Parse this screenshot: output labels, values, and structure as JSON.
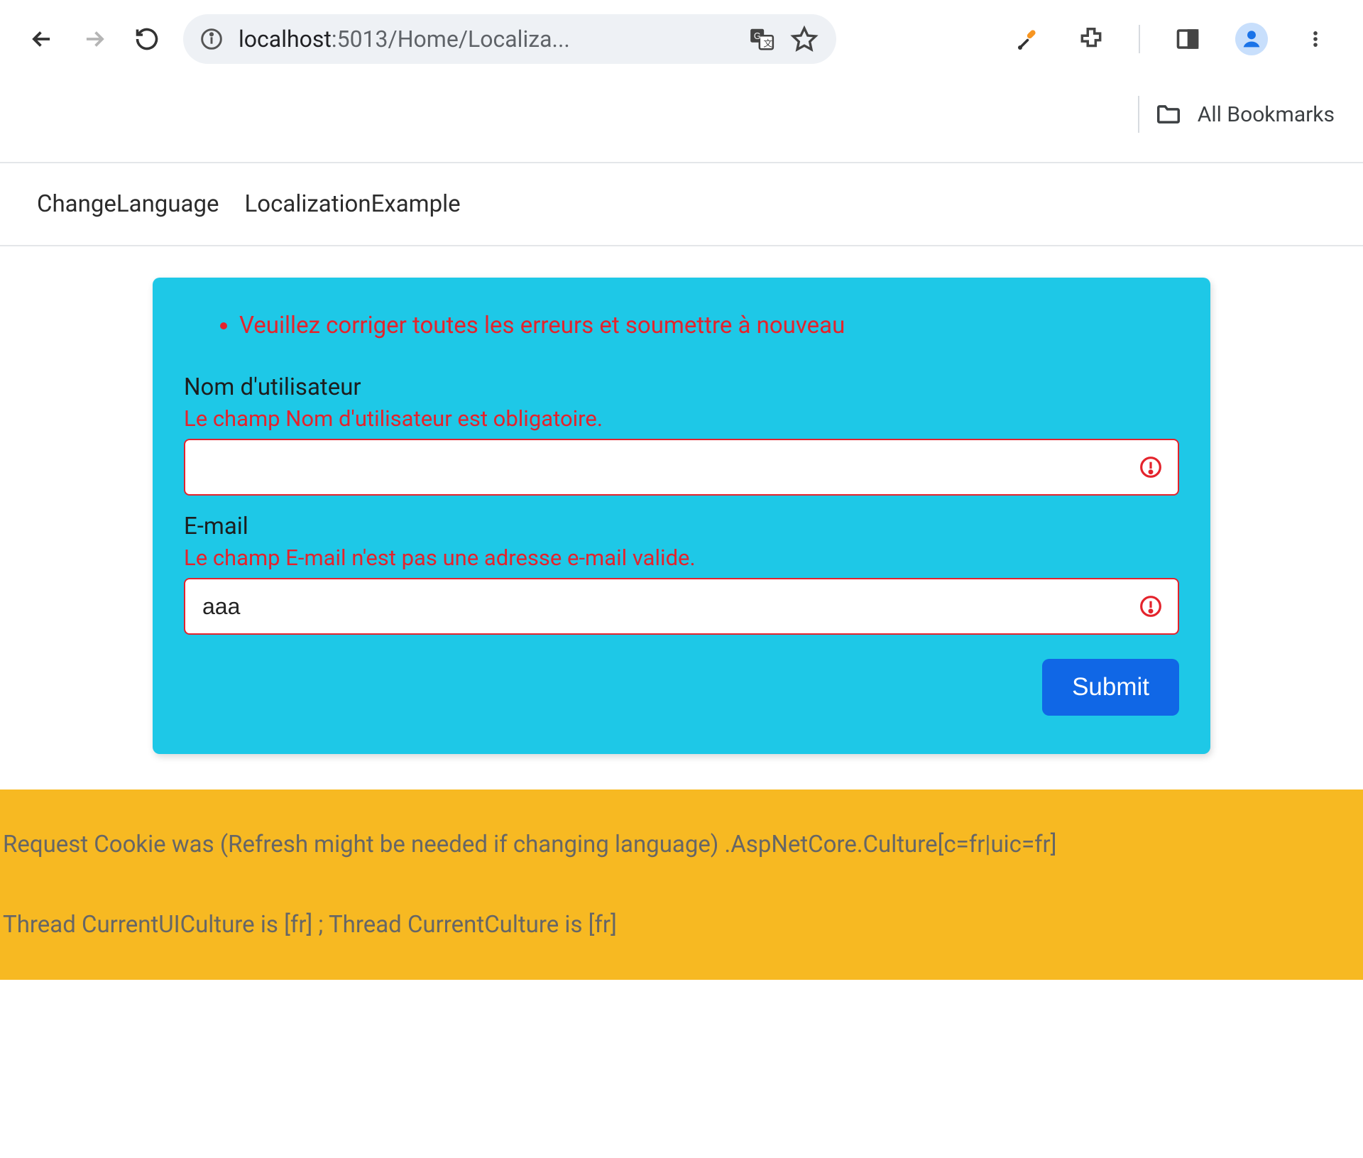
{
  "browser": {
    "url_host": "localhost",
    "url_path": ":5013/Home/Localiza..."
  },
  "bookmarks_bar": {
    "all_bookmarks_label": "All Bookmarks"
  },
  "site_nav": {
    "link1": "ChangeLanguage",
    "link2": "LocalizationExample"
  },
  "form": {
    "summary_error": "Veuillez corriger toutes les erreurs et soumettre à nouveau",
    "username": {
      "label": "Nom d'utilisateur",
      "error": "Le champ Nom d'utilisateur est obligatoire.",
      "value": ""
    },
    "email": {
      "label": "E-mail",
      "error": "Le champ E-mail n'est pas une adresse e-mail valide.",
      "value": "aaa"
    },
    "submit_label": "Submit"
  },
  "debug": {
    "line1": "Request Cookie was (Refresh might be needed if changing language) .AspNetCore.Culture[c=fr|uic=fr]",
    "line2": "Thread CurrentUICulture is [fr] ; Thread CurrentCulture is [fr]"
  }
}
